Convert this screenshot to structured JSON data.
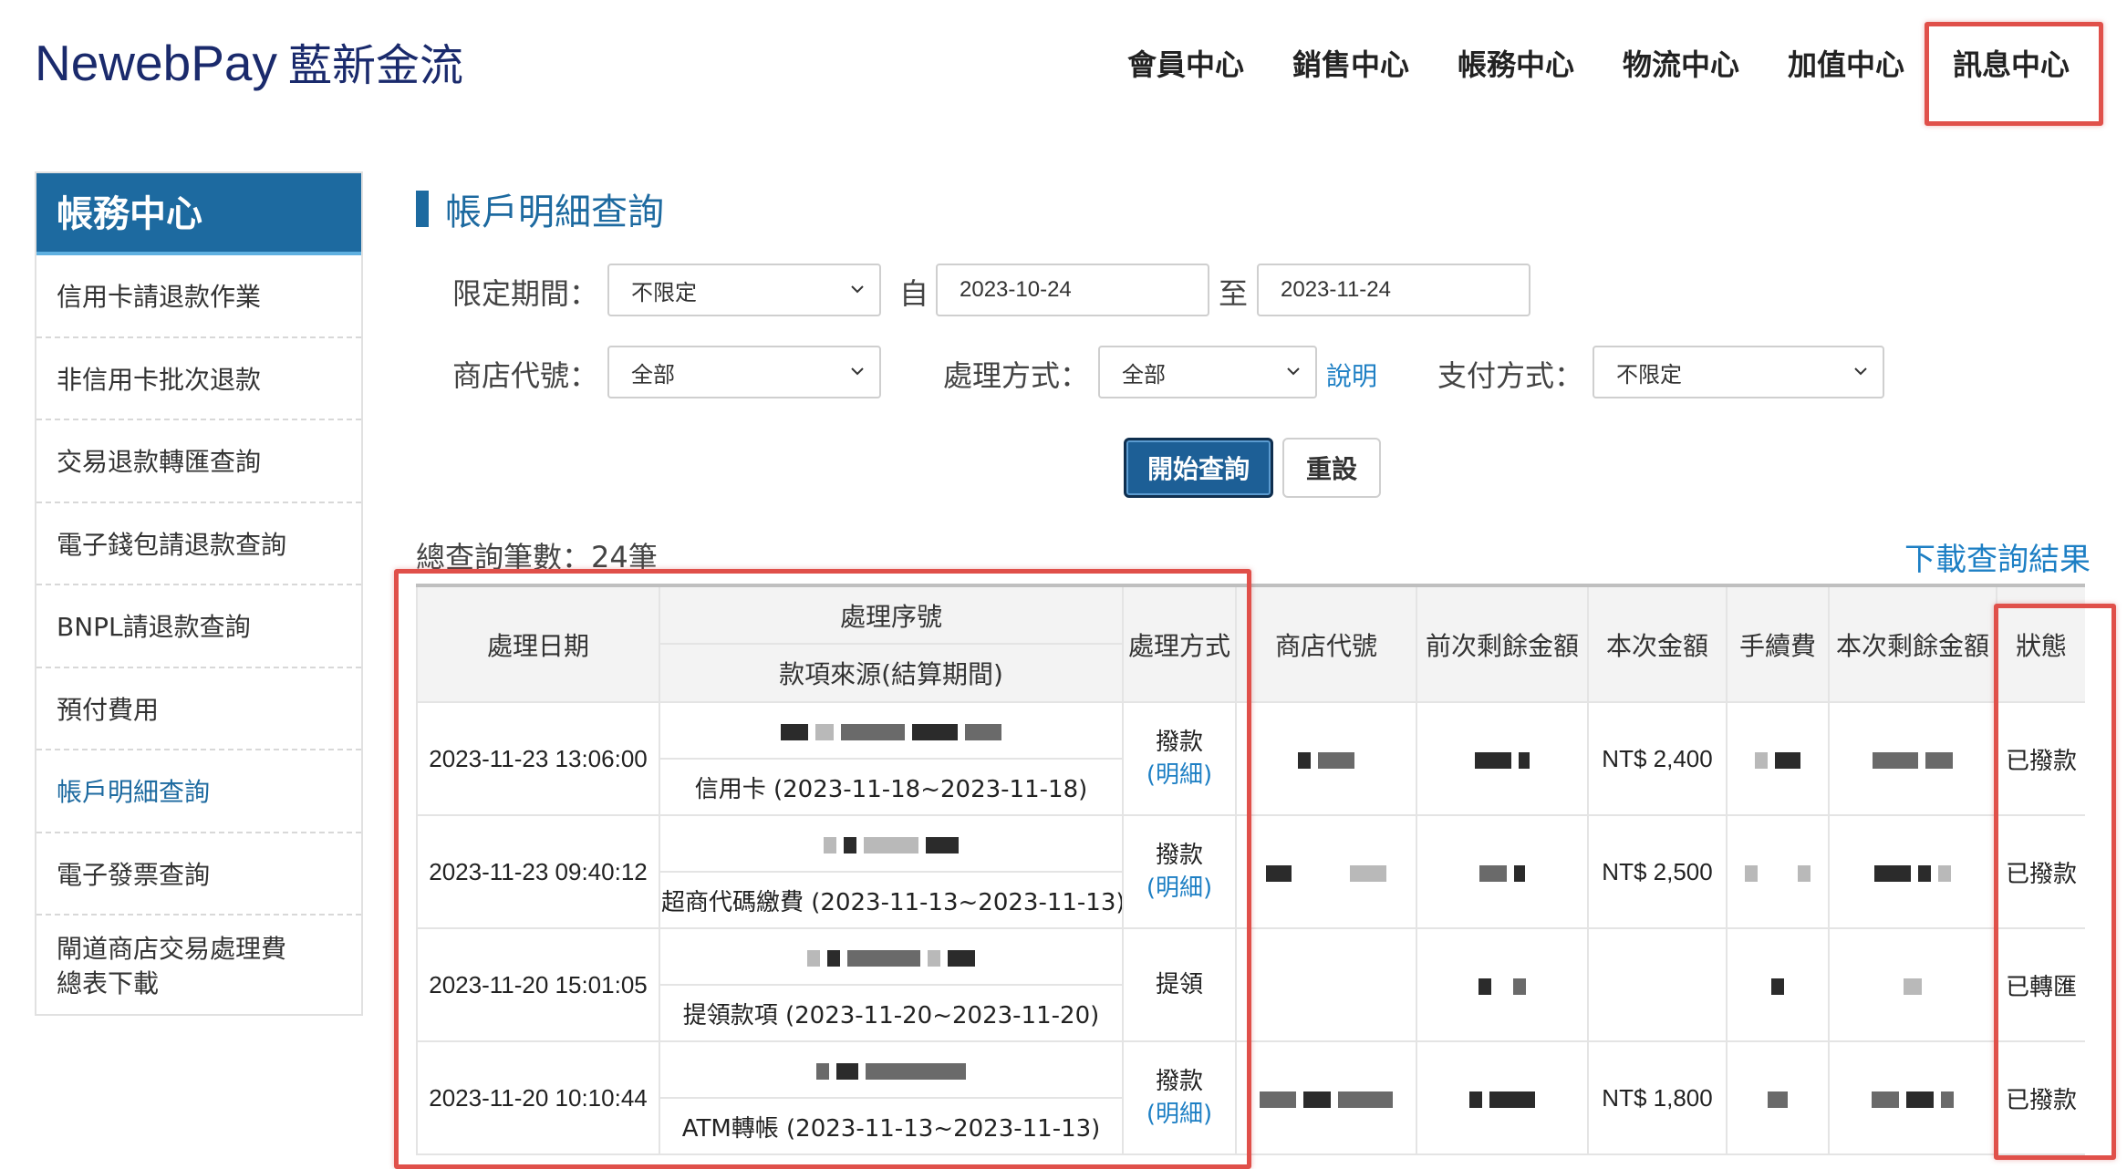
{
  "brand": {
    "name_en": "NewebPay",
    "name_zh": "藍新金流"
  },
  "topnav": [
    {
      "label": "會員中心"
    },
    {
      "label": "銷售中心"
    },
    {
      "label": "帳務中心"
    },
    {
      "label": "物流中心"
    },
    {
      "label": "加值中心"
    },
    {
      "label": "訊息中心"
    }
  ],
  "sidebar": {
    "title": "帳務中心",
    "items": [
      {
        "label": "信用卡請退款作業"
      },
      {
        "label": "非信用卡批次退款"
      },
      {
        "label": "交易退款轉匯查詢"
      },
      {
        "label": "電子錢包請退款查詢"
      },
      {
        "label": "BNPL請退款查詢"
      },
      {
        "label": "預付費用"
      },
      {
        "label": "帳戶明細查詢",
        "active": true
      },
      {
        "label": "電子發票查詢"
      },
      {
        "label_line1": "閘道商店交易處理費",
        "label_line2": "總表下載"
      }
    ]
  },
  "page": {
    "title": "帳戶明細查詢"
  },
  "filters": {
    "period_label": "限定期間：",
    "period_value": "不限定",
    "from_label": "自",
    "from_date": "2023-10-24",
    "to_label": "至",
    "to_date": "2023-11-24",
    "store_label": "商店代號：",
    "store_value": "全部",
    "method_label": "處理方式：",
    "method_value": "全部",
    "explain_link": "說明",
    "payment_label": "支付方式：",
    "payment_value": "不限定"
  },
  "buttons": {
    "search": "開始查詢",
    "reset": "重設"
  },
  "results": {
    "count_text": "總查詢筆數：24筆",
    "download": "下載查詢結果"
  },
  "table": {
    "headers": {
      "date": "處理日期",
      "serial": "處理序號",
      "source": "款項來源(結算期間)",
      "method": "處理方式",
      "store": "商店代號",
      "prev_balance": "前次剩餘金額",
      "amount": "本次金額",
      "fee": "手續費",
      "balance": "本次剩餘金額",
      "status": "狀態"
    },
    "rows": [
      {
        "date": "2023-11-23 13:06:00",
        "source": "信用卡 (2023-11-18~2023-11-18)",
        "method": "撥款",
        "detail": "(明細)",
        "amount": "NT$ 2,400",
        "status": "已撥款"
      },
      {
        "date": "2023-11-23 09:40:12",
        "source": "超商代碼繳費 (2023-11-13~2023-11-13)",
        "method": "撥款",
        "detail": "(明細)",
        "amount": "NT$ 2,500",
        "status": "已撥款"
      },
      {
        "date": "2023-11-20 15:01:05",
        "source": "提領款項 (2023-11-20~2023-11-20)",
        "method": "提領",
        "detail": "",
        "amount": "",
        "status": "已轉匯"
      },
      {
        "date": "2023-11-20 10:10:44",
        "source": "ATM轉帳 (2023-11-13~2023-11-13)",
        "method": "撥款",
        "detail": "(明細)",
        "amount": "NT$ 1,800",
        "status": "已撥款"
      }
    ]
  },
  "colors": {
    "brand": "#1a2a6c",
    "accent": "#1d6aa0",
    "link": "#1d7fc4",
    "highlight": "#e0504a"
  }
}
